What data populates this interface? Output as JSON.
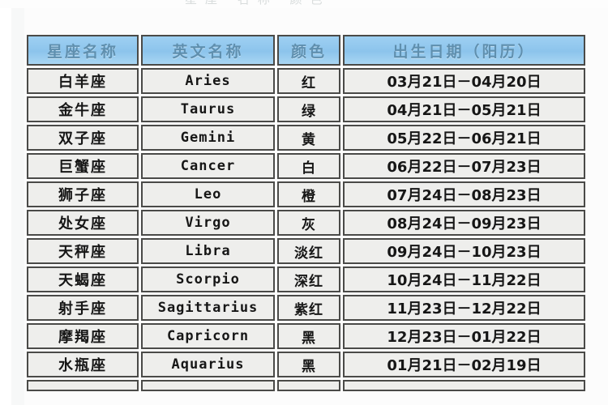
{
  "table": {
    "columns": [
      {
        "key": "cn_name",
        "label": "星座名称"
      },
      {
        "key": "en_name",
        "label": "英文名称"
      },
      {
        "key": "color",
        "label": "颜色"
      },
      {
        "key": "date_range",
        "label": "出生日期（阳历）"
      }
    ],
    "rows": [
      {
        "cn_name": "白羊座",
        "en_name": "Aries",
        "color": "红",
        "date_range": "03月21日－04月20日"
      },
      {
        "cn_name": "金牛座",
        "en_name": "Taurus",
        "color": "绿",
        "date_range": "04月21日－05月21日"
      },
      {
        "cn_name": "双子座",
        "en_name": "Gemini",
        "color": "黄",
        "date_range": "05月22日－06月21日"
      },
      {
        "cn_name": "巨蟹座",
        "en_name": "Cancer",
        "color": "白",
        "date_range": "06月22日－07月23日"
      },
      {
        "cn_name": "狮子座",
        "en_name": "Leo",
        "color": "橙",
        "date_range": "07月24日－08月23日"
      },
      {
        "cn_name": "处女座",
        "en_name": "Virgo",
        "color": "灰",
        "date_range": "08月24日－09月23日"
      },
      {
        "cn_name": "天秤座",
        "en_name": "Libra",
        "color": "淡红",
        "date_range": "09月24日－10月23日"
      },
      {
        "cn_name": "天蝎座",
        "en_name": "Scorpio",
        "color": "深红",
        "date_range": "10月24日－11月22日"
      },
      {
        "cn_name": "射手座",
        "en_name": "Sagittarius",
        "color": "紫红",
        "date_range": "11月23日－12月22日"
      },
      {
        "cn_name": "摩羯座",
        "en_name": "Capricorn",
        "color": "黑",
        "date_range": "12月23日－01月22日"
      },
      {
        "cn_name": "水瓶座",
        "en_name": "Aquarius",
        "color": "黑",
        "date_range": "01月21日－02月19日"
      }
    ]
  },
  "theme": {
    "header_bg": "#8cc4ec",
    "header_text": "#5f8fae",
    "cell_bg": "#eeeeec",
    "cell_text": "#161616",
    "border": "#4a4a48",
    "page_bg": "#fcfcfc"
  }
}
